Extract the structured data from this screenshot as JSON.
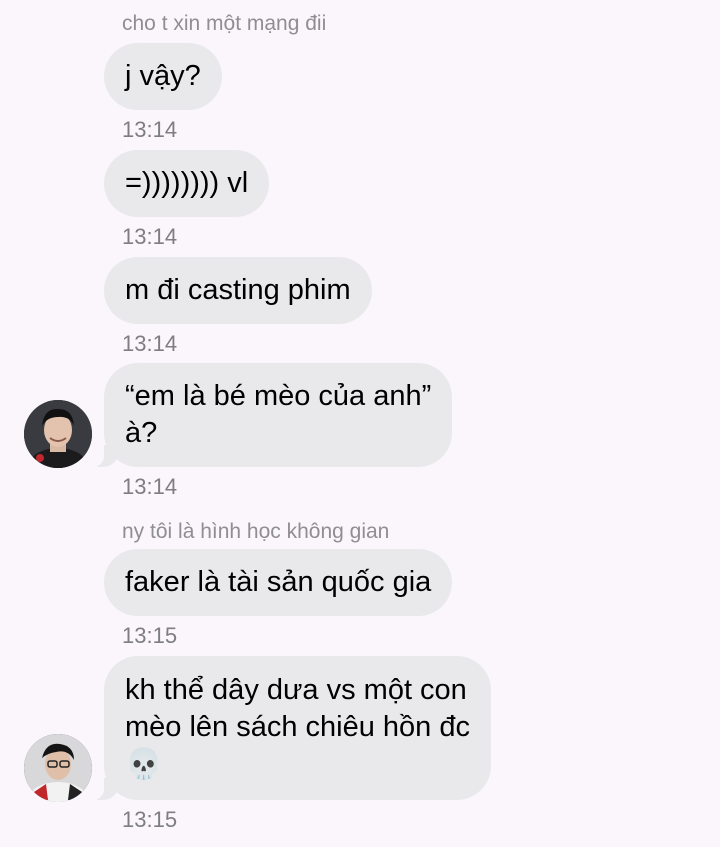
{
  "messages": [
    {
      "sender": "cho t xin một mạng đii",
      "text": "j vậy?",
      "time": "13:14"
    },
    {
      "text": "=)))))))) vl",
      "time": "13:14"
    },
    {
      "text": "m đi casting phim",
      "time": "13:14"
    },
    {
      "text_lines": [
        "“em là bé mèo của anh”",
        "à?"
      ],
      "time": "13:14",
      "avatar": "avatar-1"
    },
    {
      "sender": "ny tôi là hình học không gian",
      "text": "faker là tài sản quốc gia",
      "time": "13:15"
    },
    {
      "text_lines": [
        "kh thể dây dưa vs một con",
        "mèo lên sách chiêu hồn đc",
        "💀"
      ],
      "time": "13:15",
      "avatar": "avatar-2"
    }
  ],
  "colors": {
    "background": "#fbf6fc",
    "bubble": "#e9e9eb",
    "meta_text": "#8e8e93"
  },
  "icons": {
    "skull": "skull-emoji"
  }
}
